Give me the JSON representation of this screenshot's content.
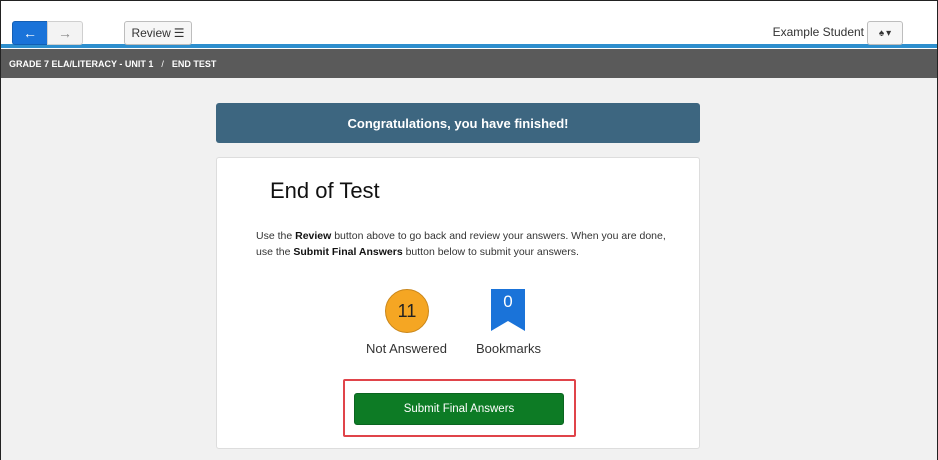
{
  "toolbar": {
    "back_icon": "arrow-left-icon",
    "forward_icon": "arrow-right-icon",
    "review_label": "Review",
    "review_icon": "list-icon",
    "student_name": "Example Student",
    "user_icon": "user-icon",
    "user_caret_icon": "caret-down-icon",
    "accent_color": "#1a73d9"
  },
  "breadcrumb": {
    "course": "GRADE 7 ELA/LITERACY - UNIT 1",
    "separator": "/",
    "page": "END TEST"
  },
  "banner": {
    "text": "Congratulations, you have finished!",
    "color": "#3d6680"
  },
  "card": {
    "title": "End of Test",
    "instr_1": "Use the ",
    "instr_review": "Review",
    "instr_2": " button above to go back and review your answers. When you are done, use the ",
    "instr_submit": "Submit Final Answers",
    "instr_3": " button below to submit your answers."
  },
  "stats": {
    "not_answered_count": "11",
    "not_answered_label": "Not Answered",
    "not_answered_color": "#f5a623",
    "bookmarks_count": "0",
    "bookmarks_label": "Bookmarks",
    "bookmarks_color": "#1a73d9"
  },
  "submit": {
    "label": "Submit Final Answers",
    "color": "#0d7b25",
    "highlight_color": "#e0444a"
  }
}
